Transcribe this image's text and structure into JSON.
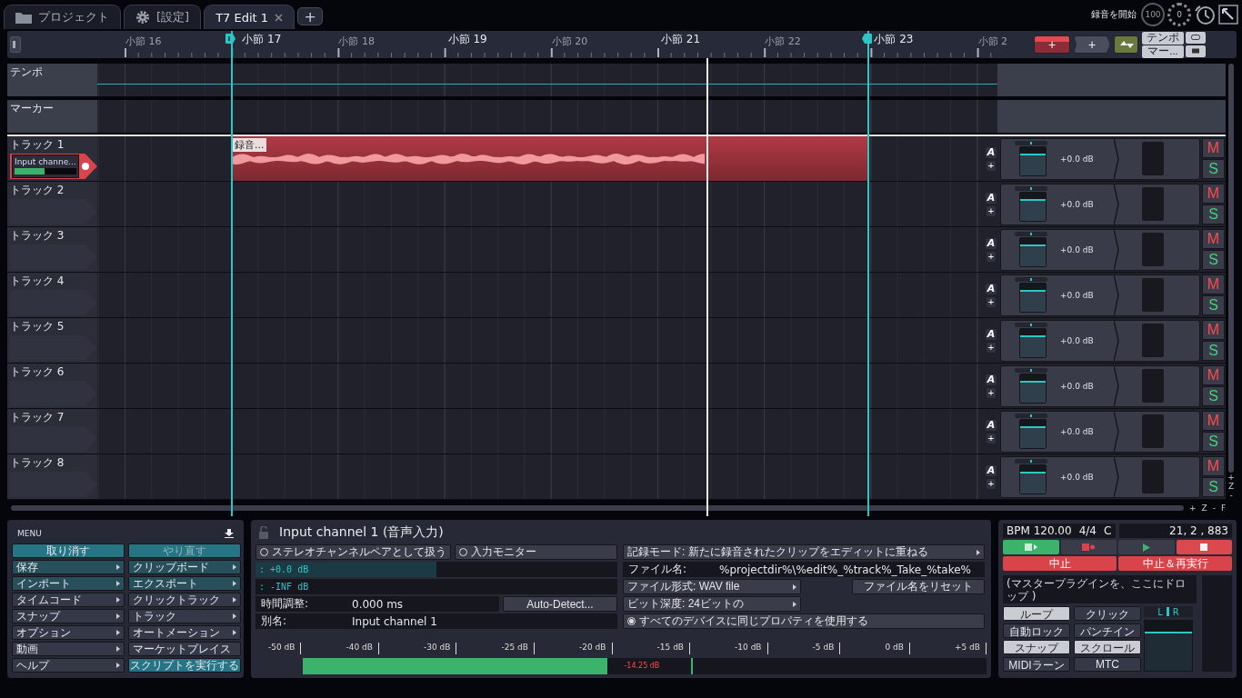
{
  "tabs": [
    {
      "label": "プロジェクト",
      "kind": "project",
      "selected": false
    },
    {
      "label": "[設定]",
      "kind": "settings",
      "selected": false
    },
    {
      "label": "T7 Edit 1",
      "kind": "edit",
      "selected": true
    }
  ],
  "new_tab": "+",
  "status": {
    "record_label": "録音を開始",
    "cpu": "100",
    "dial": "0"
  },
  "ruler": {
    "bars": [
      {
        "label": "小節 16",
        "major": false
      },
      {
        "label": "小節 17",
        "major": true
      },
      {
        "label": "小節 18",
        "major": false
      },
      {
        "label": "小節 19",
        "major": true
      },
      {
        "label": "小節 20",
        "major": false
      },
      {
        "label": "小節 21",
        "major": true
      },
      {
        "label": "小節 22",
        "major": false
      },
      {
        "label": "小節 23",
        "major": true
      },
      {
        "label": "小節 2",
        "major": false
      }
    ],
    "tool_buttons": [
      {
        "kind": "armed",
        "label": "+"
      },
      {
        "kind": "plain",
        "label": "+"
      }
    ],
    "view_buttons": [
      {
        "label": "テンポ"
      },
      {
        "label": "マー..."
      }
    ]
  },
  "lanes": [
    {
      "name": "テンポ",
      "kind": "tempo"
    },
    {
      "name": "マーカー",
      "kind": "marker"
    }
  ],
  "tracks": [
    {
      "name": "トラック 1",
      "armed": true,
      "input": {
        "label": "Input channe...",
        "level": 0.48
      },
      "clip": "録音...",
      "pan": {
        "level": 0.5
      },
      "fader": {
        "level": 0.78,
        "reading": "+0.0 dB"
      },
      "auto": "A",
      "add": "+",
      "mute": "M",
      "solo": "S"
    },
    {
      "name": "トラック 2",
      "armed": false,
      "pan": {
        "level": 0.5
      },
      "fader": {
        "level": 0.78,
        "reading": "+0.0 dB"
      },
      "auto": "A",
      "add": "+",
      "mute": "M",
      "solo": "S"
    },
    {
      "name": "トラック 3",
      "armed": false,
      "pan": {
        "level": 0.5
      },
      "fader": {
        "level": 0.78,
        "reading": "+0.0 dB"
      },
      "auto": "A",
      "add": "+",
      "mute": "M",
      "solo": "S"
    },
    {
      "name": "トラック 4",
      "armed": false,
      "pan": {
        "level": 0.5
      },
      "fader": {
        "level": 0.78,
        "reading": "+0.0 dB"
      },
      "auto": "A",
      "add": "+",
      "mute": "M",
      "solo": "S"
    },
    {
      "name": "トラック 5",
      "armed": false,
      "pan": {
        "level": 0.5
      },
      "fader": {
        "level": 0.78,
        "reading": "+0.0 dB"
      },
      "auto": "A",
      "add": "+",
      "mute": "M",
      "solo": "S"
    },
    {
      "name": "トラック 6",
      "armed": false,
      "pan": {
        "level": 0.5
      },
      "fader": {
        "level": 0.78,
        "reading": "+0.0 dB"
      },
      "auto": "A",
      "add": "+",
      "mute": "M",
      "solo": "S"
    },
    {
      "name": "トラック 7",
      "armed": false,
      "pan": {
        "level": 0.5
      },
      "fader": {
        "level": 0.78,
        "reading": "+0.0 dB"
      },
      "auto": "A",
      "add": "+",
      "mute": "M",
      "solo": "S"
    },
    {
      "name": "トラック 8",
      "armed": false,
      "pan": {
        "level": 0.5
      },
      "fader": {
        "level": 0.78,
        "reading": "+0.0 dB"
      },
      "auto": "A",
      "add": "+",
      "mute": "M",
      "solo": "S"
    }
  ],
  "zoom": {
    "horizontal": [
      "+",
      "Z",
      "-",
      "F"
    ],
    "vertical": [
      "+",
      "Z",
      "-"
    ]
  },
  "menu": {
    "title": "MENU",
    "columns": [
      [
        {
          "label": "取り消す",
          "kind": "action",
          "submenu": false,
          "disabled": false
        },
        {
          "label": "保存",
          "kind": "file",
          "submenu": true,
          "disabled": false
        },
        {
          "label": "インポート",
          "kind": "file",
          "submenu": true,
          "disabled": false
        },
        {
          "label": "タイムコード",
          "kind": "plain",
          "submenu": true,
          "disabled": false
        },
        {
          "label": "スナップ",
          "kind": "plain",
          "submenu": true,
          "disabled": false
        },
        {
          "label": "オプション",
          "kind": "plain",
          "submenu": true,
          "disabled": false
        },
        {
          "label": "動画",
          "kind": "plain",
          "submenu": true,
          "disabled": false
        },
        {
          "label": "ヘルプ",
          "kind": "plain",
          "submenu": true,
          "disabled": false
        }
      ],
      [
        {
          "label": "やり直す",
          "kind": "action",
          "submenu": false,
          "disabled": true
        },
        {
          "label": "クリップボード",
          "kind": "file",
          "submenu": true,
          "disabled": false
        },
        {
          "label": "エクスポート",
          "kind": "file",
          "submenu": true,
          "disabled": false
        },
        {
          "label": "クリックトラック",
          "kind": "plain",
          "submenu": true,
          "disabled": false
        },
        {
          "label": "トラック",
          "kind": "plain",
          "submenu": true,
          "disabled": false
        },
        {
          "label": "オートメーション",
          "kind": "plain",
          "submenu": true,
          "disabled": false
        },
        {
          "label": "マーケットプレイス",
          "kind": "plain",
          "submenu": false,
          "disabled": false
        },
        {
          "label": "スクリプトを実行する",
          "kind": "action",
          "submenu": false,
          "disabled": false
        }
      ]
    ]
  },
  "input_panel": {
    "title": "Input channel 1 (音声入力)",
    "options": [
      {
        "label": "ステレオチャンネルペアとして扱う",
        "checked": false
      },
      {
        "label": "入力モニター",
        "checked": false
      }
    ],
    "meters": [
      {
        "reading": ": +0.0 dB",
        "level": 0.5
      },
      {
        "reading": ": -INF dB",
        "level": 0
      }
    ],
    "offset": {
      "label": "時間調整:",
      "value": "0.000 ms"
    },
    "detect_button": "Auto-Detect...",
    "alias": {
      "label": "別名:",
      "value": "Input channel 1"
    },
    "record_mode": "記録モード: 新たに録音されたクリップをエディットに重ねる",
    "filename": {
      "label": "ファイル名:",
      "value": "%projectdir%\\%edit%_%track%_Take_%take%"
    },
    "file_format": "ファイル形式: WAV file",
    "reset_button": "ファイル名をリセット",
    "bit_depth": "ビット深度: 24ビットの",
    "all_devices": {
      "label": "すべてのデバイスに同じプロパティを使用する",
      "checked": true
    },
    "level_meter": {
      "scale": [
        "-50 dB",
        "-40 dB",
        "-30 dB",
        "-25 dB",
        "-20 dB",
        "-15 dB",
        "-10 dB",
        "-5 dB",
        "0 dB",
        "+5 dB"
      ],
      "level": 0.445,
      "peak": {
        "level": 0.568,
        "reading": "-14.25 dB"
      }
    }
  },
  "transport": {
    "bpm": "BPM 120.00",
    "signature": "4/4",
    "key": "C",
    "position": "21, 2 , 883",
    "buttons": [
      {
        "kind": "return-play"
      },
      {
        "kind": "record"
      },
      {
        "kind": "play"
      },
      {
        "kind": "stop"
      }
    ],
    "abort_buttons": [
      "中止",
      "中止＆再実行"
    ],
    "drop_hint": "(マスタープラグインを、ここにドロップ )",
    "toggles": [
      {
        "label": "ループ",
        "on": true
      },
      {
        "label": "クリック",
        "on": false
      },
      {
        "label": "自動ロック",
        "on": false
      },
      {
        "label": "パンチイン",
        "on": false
      },
      {
        "label": "スナップ",
        "on": true
      },
      {
        "label": "スクロール",
        "on": true
      },
      {
        "label": "MIDIラーン",
        "on": false
      },
      {
        "label": "MTC",
        "on": false
      }
    ],
    "master": {
      "left": "L",
      "right": "R",
      "level": 0.78
    }
  }
}
